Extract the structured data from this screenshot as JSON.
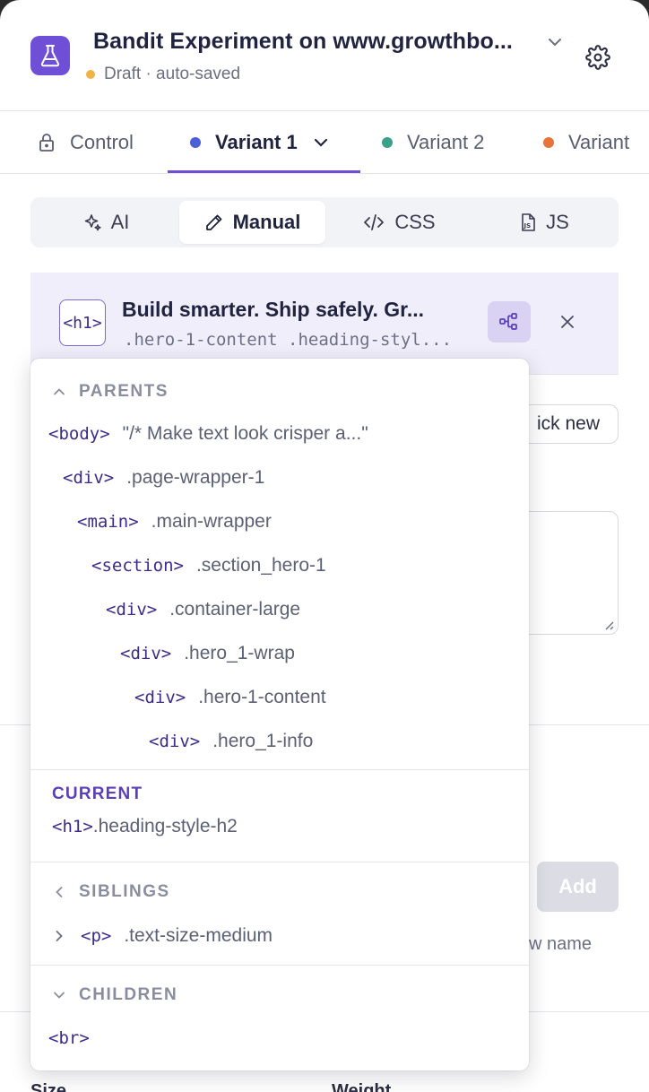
{
  "header": {
    "title": "Bandit Experiment on www.growthbo...",
    "status": "Draft · auto-saved",
    "status_color": "#f3b244",
    "accent": "#6e4fd6"
  },
  "variant_tabs": [
    {
      "label": "Control",
      "icon": "lock-icon",
      "active": false
    },
    {
      "label": "Variant 1",
      "dot_color": "#4a5fd8",
      "active": true
    },
    {
      "label": "Variant 2",
      "dot_color": "#3aa08a",
      "active": false
    },
    {
      "label": "Variant",
      "dot_color": "#e8733a",
      "active": false
    }
  ],
  "mode_tabs": [
    {
      "label": "AI",
      "icon": "sparkle-icon",
      "active": false
    },
    {
      "label": "Manual",
      "icon": "pencil-icon",
      "active": true
    },
    {
      "label": "CSS",
      "icon": "code-icon",
      "active": false
    },
    {
      "label": "JS",
      "icon": "js-file-icon",
      "active": false
    }
  ],
  "selected": {
    "tag": "<h1>",
    "title": "Build smarter. Ship safely. Gr...",
    "selector": ".hero-1-content .heading-styl..."
  },
  "background": {
    "pick_new": "ick new",
    "add": "Add",
    "new_name": "w name",
    "size_label": "Size",
    "weight_label": "Weight"
  },
  "dropdown": {
    "parents_label": "PARENTS",
    "parents": [
      {
        "tag": "<body>",
        "cls": "\"/* Make text look crisper a...\""
      },
      {
        "tag": "<div>",
        "cls": ".page-wrapper-1"
      },
      {
        "tag": "<main>",
        "cls": ".main-wrapper"
      },
      {
        "tag": "<section>",
        "cls": ".section_hero-1"
      },
      {
        "tag": "<div>",
        "cls": ".container-large"
      },
      {
        "tag": "<div>",
        "cls": ".hero_1-wrap"
      },
      {
        "tag": "<div>",
        "cls": ".hero-1-content"
      },
      {
        "tag": "<div>",
        "cls": ".hero_1-info"
      }
    ],
    "current_label": "CURRENT",
    "current": {
      "tag": "<h1>",
      "cls": ".heading-style-h2"
    },
    "siblings_label": "SIBLINGS",
    "siblings": [
      {
        "tag": "<p>",
        "cls": ".text-size-medium"
      }
    ],
    "children_label": "CHILDREN",
    "children": [
      {
        "tag": "<br>",
        "cls": ""
      }
    ]
  }
}
